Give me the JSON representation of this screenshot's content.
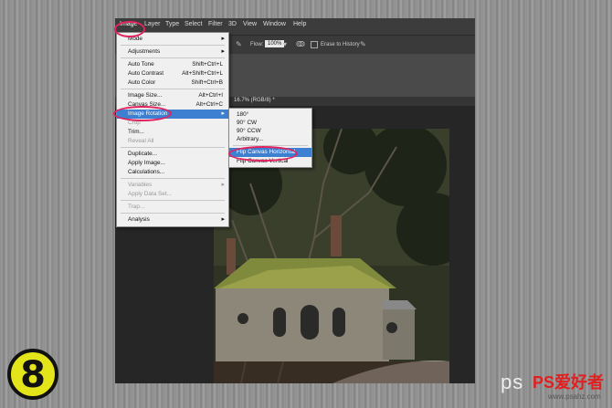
{
  "menubar": {
    "items": [
      "Image",
      "Layer",
      "Type",
      "Select",
      "Filter",
      "3D",
      "View",
      "Window",
      "Help"
    ]
  },
  "options": {
    "flow_label": "Flow:",
    "flow_value": "100%",
    "erase_label": "Erase to History"
  },
  "document": {
    "tab_title": "16.7% (RGB/8) *"
  },
  "image_menu": {
    "items": [
      {
        "label": "Mode",
        "shortcut": "",
        "submenu": true,
        "disabled": false
      },
      {
        "label": "Adjustments",
        "shortcut": "",
        "submenu": true,
        "disabled": false
      },
      {
        "label": "Auto Tone",
        "shortcut": "Shift+Ctrl+L",
        "submenu": false,
        "disabled": false
      },
      {
        "label": "Auto Contrast",
        "shortcut": "Alt+Shift+Ctrl+L",
        "submenu": false,
        "disabled": false
      },
      {
        "label": "Auto Color",
        "shortcut": "Shift+Ctrl+B",
        "submenu": false,
        "disabled": false
      },
      {
        "label": "Image Size...",
        "shortcut": "Alt+Ctrl+I",
        "submenu": false,
        "disabled": false
      },
      {
        "label": "Canvas Size...",
        "shortcut": "Alt+Ctrl+C",
        "submenu": false,
        "disabled": false
      },
      {
        "label": "Image Rotation",
        "shortcut": "",
        "submenu": true,
        "disabled": false,
        "selected": true
      },
      {
        "label": "Crop",
        "shortcut": "",
        "submenu": false,
        "disabled": true
      },
      {
        "label": "Trim...",
        "shortcut": "",
        "submenu": false,
        "disabled": false
      },
      {
        "label": "Reveal All",
        "shortcut": "",
        "submenu": false,
        "disabled": true
      },
      {
        "label": "Duplicate...",
        "shortcut": "",
        "submenu": false,
        "disabled": false
      },
      {
        "label": "Apply Image...",
        "shortcut": "",
        "submenu": false,
        "disabled": false
      },
      {
        "label": "Calculations...",
        "shortcut": "",
        "submenu": false,
        "disabled": false
      },
      {
        "label": "Variables",
        "shortcut": "",
        "submenu": true,
        "disabled": true
      },
      {
        "label": "Apply Data Set...",
        "shortcut": "",
        "submenu": false,
        "disabled": true
      },
      {
        "label": "Trap...",
        "shortcut": "",
        "submenu": false,
        "disabled": true
      },
      {
        "label": "Analysis",
        "shortcut": "",
        "submenu": true,
        "disabled": false
      }
    ]
  },
  "rotation_menu": {
    "items": [
      {
        "label": "180°"
      },
      {
        "label": "90° CW"
      },
      {
        "label": "90° CCW"
      },
      {
        "label": "Arbitrary..."
      },
      {
        "label": "Flip Canvas Horizontal",
        "selected": true
      },
      {
        "label": "Flip Canvas Vertical"
      }
    ]
  },
  "step_badge": "8",
  "watermark": {
    "left": "ps",
    "brand": "PS爱好者",
    "url": "www.psahz.com"
  },
  "colors": {
    "highlight": "#3d7fd0",
    "annotation_ring": "#e0245e",
    "badge": "#e4e41a"
  }
}
